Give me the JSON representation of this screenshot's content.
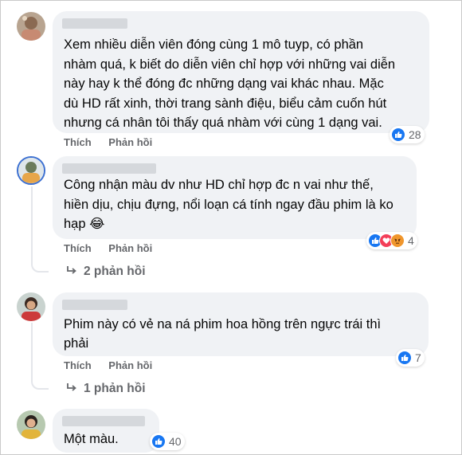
{
  "comments": [
    {
      "lines": [
        "Xem nhiều diễn viên đóng cùng 1 mô tuyp, có phần",
        "nhàm quá, k biết do diễn viên chỉ hợp với những vai diễn",
        "này hay k thể đóng đc những dạng vai khác nhau. Mặc",
        "dù HD rất xinh, thời trang sành điệu, biểu cảm cuốn hút",
        "nhưng cá nhân tôi thấy quá nhàm với cùng 1 dạng vai."
      ],
      "like_label": "Thích",
      "reply_label": "Phản hồi",
      "reaction_count": "28"
    },
    {
      "lines": [
        "Công nhận màu dv như HD chỉ hợp đc n vai như thế,",
        "hiền dịu, chịu đựng, nổi loạn cá tính ngay đầu phim là ko",
        "hạp 😂"
      ],
      "like_label": "Thích",
      "reply_label": "Phản hồi",
      "reaction_count": "4",
      "replies_label": "2 phản hồi"
    },
    {
      "lines": [
        "Phim này có vẻ na ná phim hoa hồng trên ngực trái thì",
        "phải"
      ],
      "like_label": "Thích",
      "reply_label": "Phản hồi",
      "reaction_count": "7",
      "replies_label": "1 phản hồi"
    },
    {
      "lines": [
        "Một màu."
      ],
      "reaction_count": "40"
    }
  ],
  "icons": {
    "like": "thumbs-up-icon",
    "love": "heart-icon",
    "angry": "angry-face-icon",
    "reply_arrow": "reply-arrow-icon"
  },
  "colors": {
    "bubble_bg": "#f0f2f5",
    "meta_text": "#65676b",
    "like_blue": "#1877f2",
    "love_red": "#f33e58",
    "angry_orange": "#f0962c"
  }
}
